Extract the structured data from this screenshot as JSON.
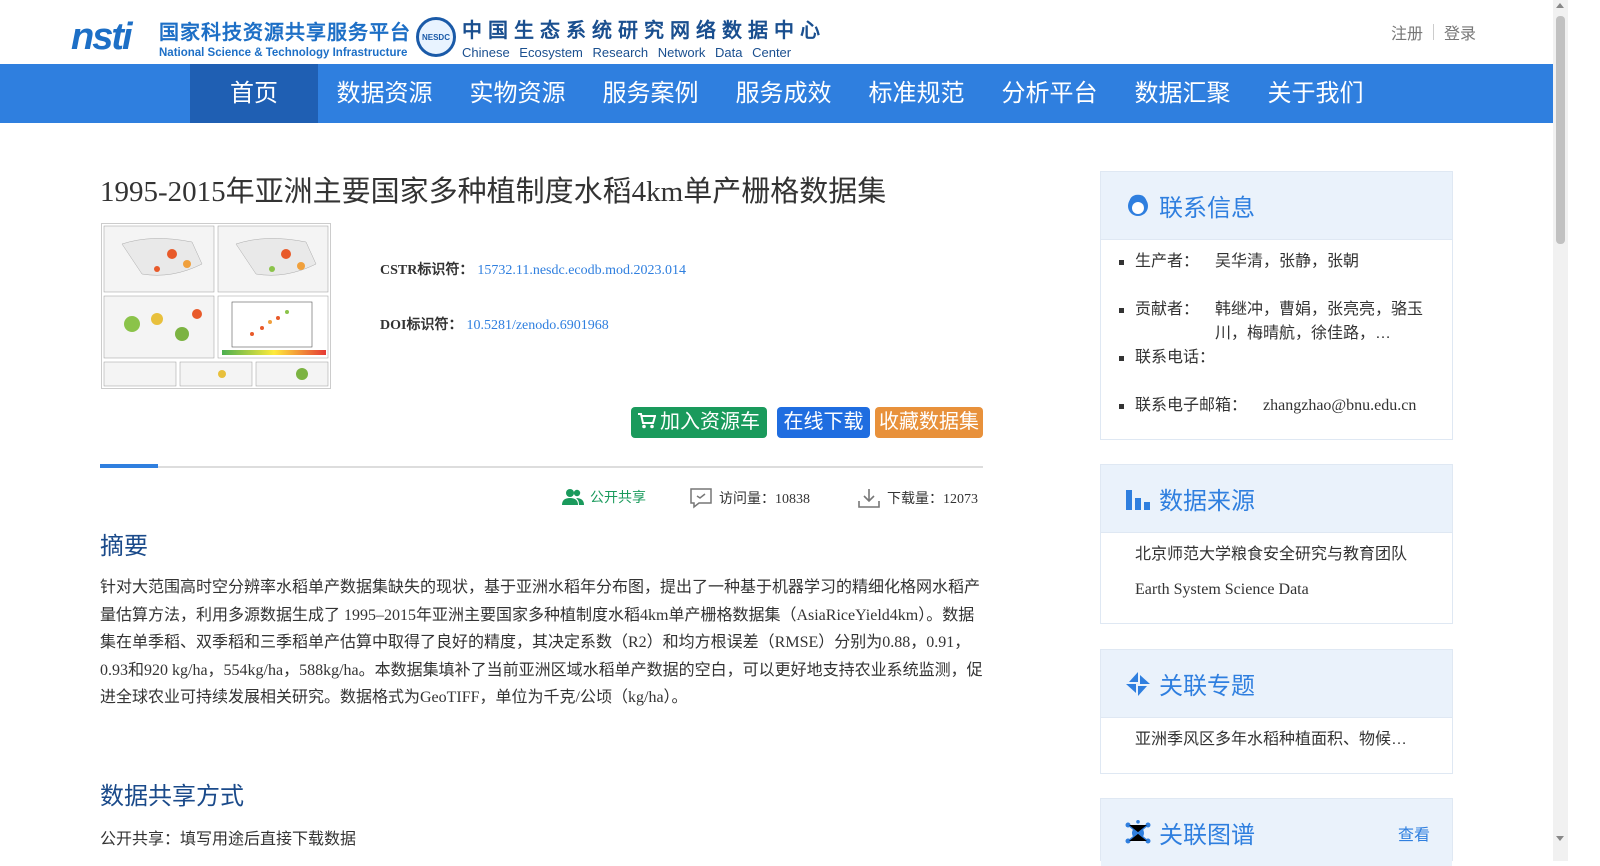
{
  "header": {
    "logo1": {
      "mark": "nsti",
      "cn": "国家科技资源共享服务平台",
      "en": "National Science & Technology Infrastructure"
    },
    "logo2": {
      "badge": "NESDC",
      "cn": "中国生态系统研究网络数据中心",
      "en": "Chinese Ecosystem Research Network Data Center"
    },
    "register": "注册",
    "login": "登录"
  },
  "nav": [
    "首页",
    "数据资源",
    "实物资源",
    "服务案例",
    "服务成效",
    "标准规范",
    "分析平台",
    "数据汇聚",
    "关于我们"
  ],
  "dataset": {
    "title": "1995-2015年亚洲主要国家多种植制度水稻4km单产栅格数据集",
    "cstr_label": "CSTR标识符：",
    "cstr_value": "15732.11.nesdc.ecodb.mod.2023.014",
    "doi_label": "DOI标识符：",
    "doi_value": "10.5281/zenodo.6901968",
    "btn_cart": "加入资源车",
    "btn_download": "在线下载",
    "btn_favorite": "收藏数据集",
    "stat_open": "公开共享",
    "stat_visits": "访问量：10838",
    "stat_downloads": "下载量：12073",
    "abstract_heading": "摘要",
    "abstract": "针对大范围高时空分辨率水稻单产数据集缺失的现状，基于亚洲水稻年分布图，提出了一种基于机器学习的精细化格网水稻产量估算方法，利用多源数据生成了 1995–2015年亚洲主要国家多种植制度水稻4km单产栅格数据集（AsiaRiceYield4km）。数据集在单季稻、双季稻和三季稻单产估算中取得了良好的精度，其决定系数（R2）和均方根误差（RMSE）分别为0.88，0.91，0.93和920 kg/ha，554kg/ha，588kg/ha。本数据集填补了当前亚洲区域水稻单产数据的空白，可以更好地支持农业系统监测，促进全球农业可持续发展相关研究。数据格式为GeoTIFF，单位为千克/公顷（kg/ha）。",
    "share_heading": "数据共享方式",
    "share_text": "公开共享：填写用途后直接下载数据"
  },
  "sidebar": {
    "contact": {
      "title": "联系信息",
      "items": [
        {
          "k": "生产者：",
          "v": "吴华清，张静，张朝"
        },
        {
          "k": "贡献者：",
          "v": "韩继冲，曹娟，张亮亮，骆玉川，梅晴航，徐佳路，…"
        },
        {
          "k": "联系电话：",
          "v": ""
        },
        {
          "k": "联系电子邮箱：",
          "v": "zhangzhao@bnu.edu.cn"
        }
      ]
    },
    "source": {
      "title": "数据来源",
      "items": [
        "北京师范大学粮食安全研究与教育团队",
        "Earth System Science Data"
      ]
    },
    "topic": {
      "title": "关联专题",
      "items": [
        "亚洲季风区多年水稻种植面积、物候…"
      ]
    },
    "graph": {
      "title": "关联图谱",
      "more": "查看"
    }
  },
  "colors": {
    "nav_bg": "#2f7fdf",
    "nav_active": "#1f5fb3",
    "green": "#1a9a5c",
    "blue_btn": "#1f6de0",
    "orange": "#e8913b"
  }
}
